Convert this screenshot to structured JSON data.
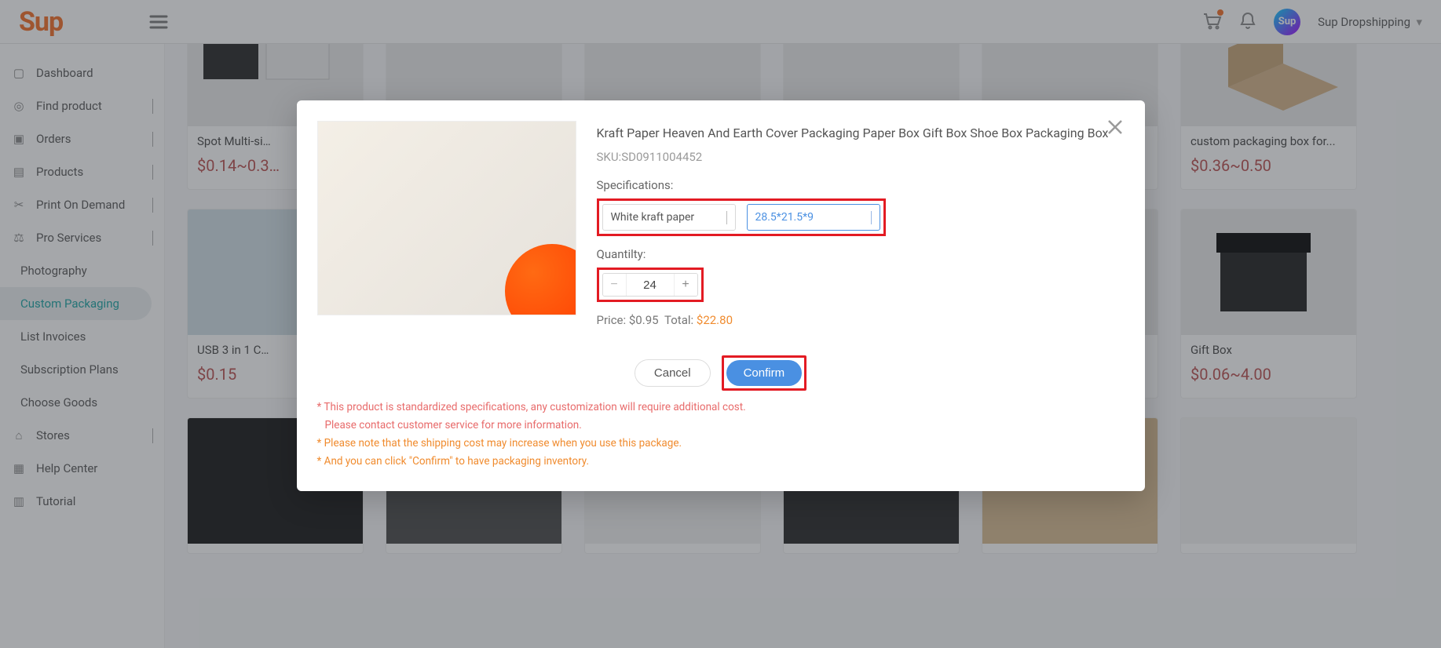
{
  "header": {
    "logo_text": "Sup",
    "user_name": "Sup Dropshipping"
  },
  "sidebar": {
    "items": [
      {
        "label": "Dashboard"
      },
      {
        "label": "Find product",
        "expandable": true
      },
      {
        "label": "Orders",
        "expandable": true
      },
      {
        "label": "Products",
        "expandable": true
      },
      {
        "label": "Print On Demand",
        "expandable": true
      },
      {
        "label": "Pro Services",
        "expandable": true,
        "expanded": true
      },
      {
        "label": "Photography",
        "sub": true
      },
      {
        "label": "Custom Packaging",
        "sub": true,
        "active": true
      },
      {
        "label": "List Invoices",
        "sub": true
      },
      {
        "label": "Subscription Plans",
        "sub": true
      },
      {
        "label": "Choose Goods",
        "sub": true
      },
      {
        "label": "Stores",
        "expandable": true
      },
      {
        "label": "Help Center"
      },
      {
        "label": "Tutorial"
      }
    ]
  },
  "products_row1": [
    {
      "title": "Spot Multi-si…",
      "price": "$0.14~0.3…"
    },
    {
      "title": "",
      "price": ""
    },
    {
      "title": "",
      "price": ""
    },
    {
      "title": "",
      "price": ""
    },
    {
      "title": "",
      "price": ""
    },
    {
      "title": "custom packaging box for...",
      "price": "$0.36~0.50"
    }
  ],
  "products_row2": [
    {
      "title": "USB 3 in 1 C…",
      "price": "$0.15"
    },
    {
      "title": "",
      "price": ""
    },
    {
      "title": "",
      "price": ""
    },
    {
      "title": "",
      "price": ""
    },
    {
      "title": "",
      "price": ""
    },
    {
      "title": "Gift Box",
      "price": "$0.06~4.00"
    }
  ],
  "modal": {
    "title": "Kraft Paper Heaven And Earth Cover Packaging Paper Box Gift Box Shoe Box Packaging Box",
    "sku_label": "SKU:",
    "sku_value": "SD0911004452",
    "spec_label": "Specifications:",
    "spec_select1": "White kraft paper",
    "spec_select2": "28.5*21.5*9",
    "qty_label": "Quantilty:",
    "qty_value": "24",
    "price_label": "Price:",
    "price_value": "$0.95",
    "total_label": "Total:",
    "total_value": "$22.80",
    "cancel": "Cancel",
    "confirm": "Confirm",
    "note1a": "* This product is standardized specifications, any customization will require additional cost.",
    "note1b": "Please contact customer service for more information.",
    "note2": "* Please note that the shipping cost may increase when you use this package.",
    "note3": "* And you can click \"Confirm\" to have packaging inventory."
  }
}
